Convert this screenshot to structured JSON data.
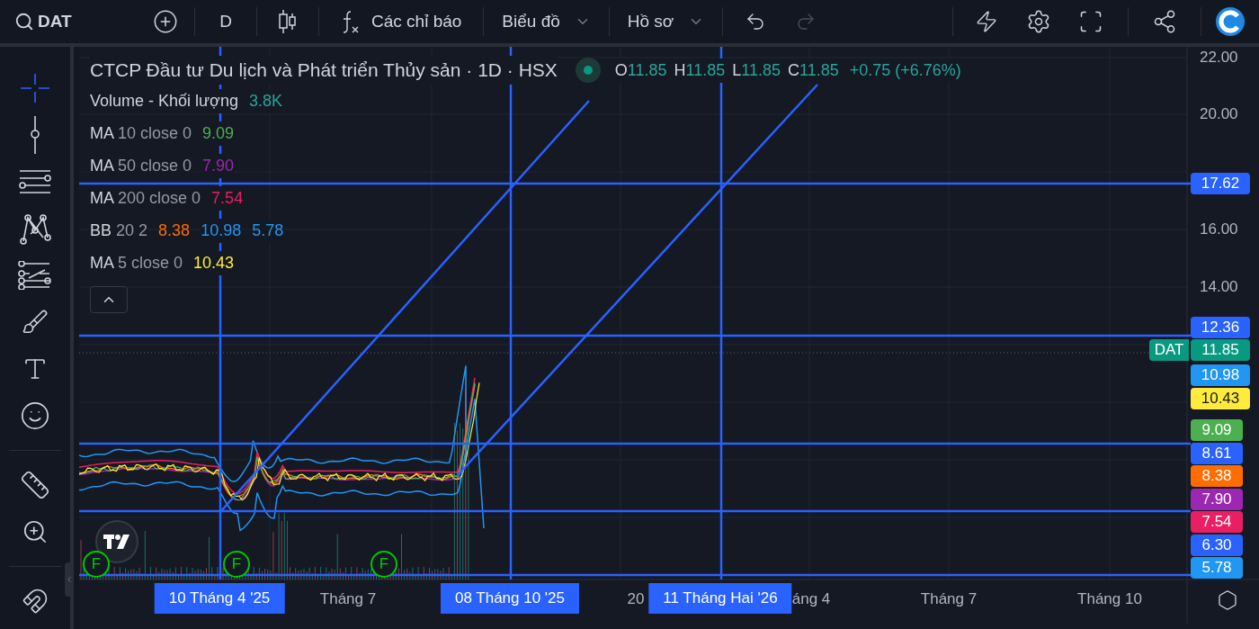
{
  "toolbar": {
    "symbol": "DAT",
    "interval": "D",
    "indicators": "Các chỉ báo",
    "chart_menu": "Biểu đồ",
    "profile_menu": "Hồ sơ",
    "undo_disabled": false,
    "redo_disabled": true
  },
  "tools": [
    {
      "kind": "crosshair",
      "selected": true
    },
    {
      "kind": "trendline",
      "selected": false
    },
    {
      "kind": "channels",
      "selected": false
    },
    {
      "kind": "pattern",
      "selected": false
    },
    {
      "kind": "forecast",
      "selected": false
    },
    {
      "kind": "brush",
      "selected": false
    },
    {
      "kind": "text",
      "selected": false
    },
    {
      "kind": "emoji",
      "selected": false
    },
    {
      "kind": "ruler",
      "selected": false
    },
    {
      "kind": "zoom",
      "selected": false
    },
    {
      "kind": "magnet",
      "selected": false
    }
  ],
  "legend": {
    "title": "CTCP Đầu tư Du lịch và Phát triển Thủy sản · 1D · HSX",
    "ohlc": [
      {
        "label": "O",
        "value": "11.85"
      },
      {
        "label": "H",
        "value": "11.85"
      },
      {
        "label": "L",
        "value": "11.85"
      },
      {
        "label": "C",
        "value": "11.85"
      }
    ],
    "change": "+0.75 (+6.76%)",
    "volume": {
      "label": "Volume - Khối lượng",
      "value": "3.8K",
      "color": "#26a69a"
    },
    "indicators": [
      {
        "name": "MA",
        "params": "10 close 0",
        "values": [
          {
            "text": "9.09",
            "color": "#4caf50"
          }
        ]
      },
      {
        "name": "MA",
        "params": "50 close 0",
        "values": [
          {
            "text": "7.90",
            "color": "#9c27b0"
          }
        ]
      },
      {
        "name": "MA",
        "params": "200 close 0",
        "values": [
          {
            "text": "7.54",
            "color": "#e91e63"
          }
        ]
      },
      {
        "name": "BB",
        "params": "20 2",
        "values": [
          {
            "text": "8.38",
            "color": "#ff6d00"
          },
          {
            "text": "10.98",
            "color": "#2196f3"
          },
          {
            "text": "5.78",
            "color": "#2196f3"
          }
        ]
      },
      {
        "name": "MA",
        "params": "5 close 0",
        "values": [
          {
            "text": "10.43",
            "color": "#ffeb3b"
          }
        ]
      }
    ]
  },
  "price_axis": {
    "ticks": [
      "22.00",
      "20.00",
      "16.00",
      "14.00"
    ],
    "markers": [
      {
        "text": "17.62",
        "color": "#2962ff"
      },
      {
        "text": "12.36",
        "color": "#2962ff"
      },
      {
        "text": "11.85",
        "color": "#089981",
        "tag": "DAT"
      },
      {
        "text": "10.98",
        "color": "#2196f3"
      },
      {
        "text": "10.43",
        "color": "#ffeb3b"
      },
      {
        "text": "9.09",
        "color": "#4caf50"
      },
      {
        "text": "8.61",
        "color": "#2962ff"
      },
      {
        "text": "8.38",
        "color": "#ff6d00"
      },
      {
        "text": "7.90",
        "color": "#9c27b0"
      },
      {
        "text": "7.54",
        "color": "#e91e63"
      },
      {
        "text": "6.30",
        "color": "#2962ff"
      },
      {
        "text": "5.78",
        "color": "#2196f3"
      }
    ]
  },
  "time_axis": {
    "labels": [
      "Tháng 7",
      "20",
      "áng 4",
      "Tháng 7",
      "Tháng 10"
    ],
    "markers": [
      "10 Tháng 4 '25",
      "08 Tháng 10 '25",
      "11 Tháng Hai '26"
    ]
  },
  "events": [
    "F",
    "F",
    "F"
  ]
}
